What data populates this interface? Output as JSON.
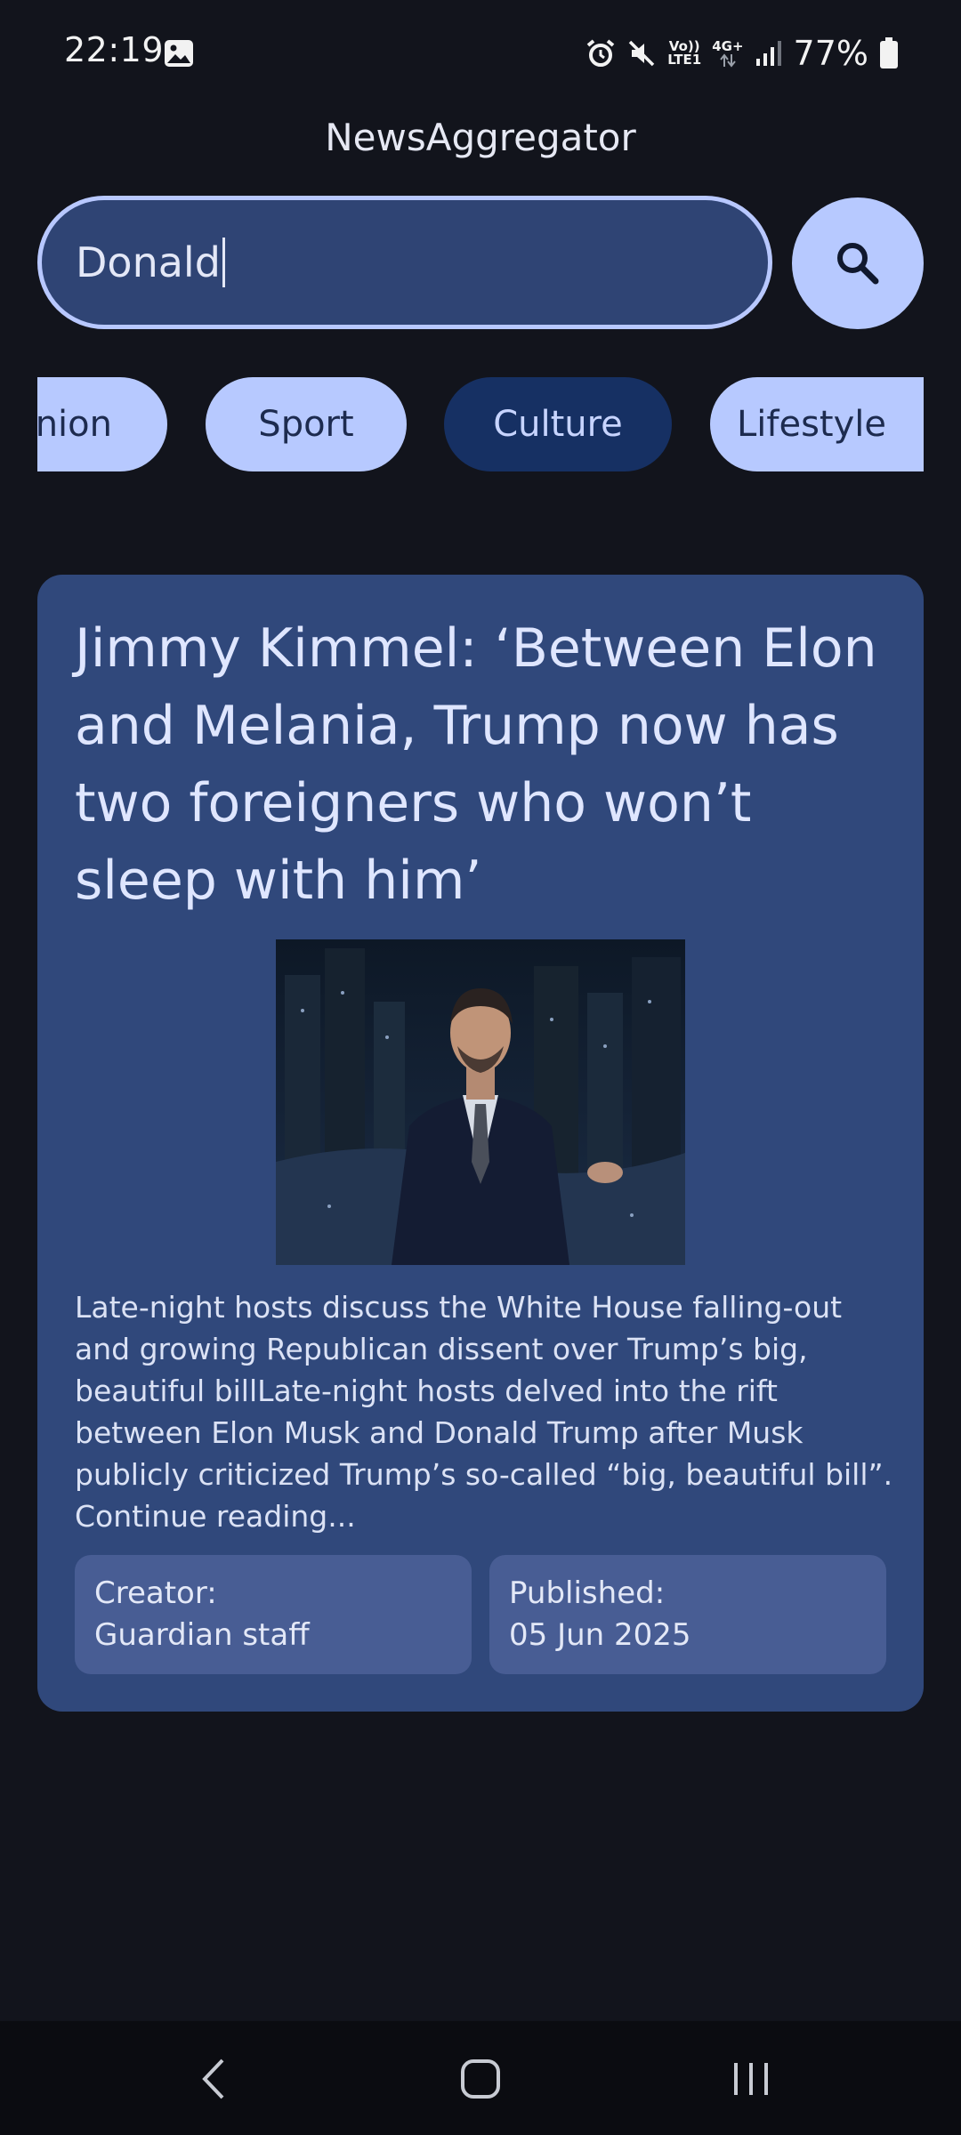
{
  "status_bar": {
    "time": "22:19",
    "network_top": "Vo))",
    "network_bottom": "LTE1",
    "data_type": "4G+",
    "battery": "77%"
  },
  "app": {
    "title": "NewsAggregator"
  },
  "search": {
    "value": "Donald",
    "icon": "search-icon"
  },
  "categories": [
    {
      "label": "inion",
      "selected": false
    },
    {
      "label": "Sport",
      "selected": false
    },
    {
      "label": "Culture",
      "selected": true
    },
    {
      "label": "Lifestyle",
      "selected": false
    }
  ],
  "article": {
    "title": "Jimmy Kimmel: ‘Between Elon and Melania, Trump now has two foreigners who won’t sleep with him’",
    "description": "Late-night hosts discuss the White House falling-out and growing Republican dissent over Trump’s big, beautiful billLate-night hosts delved into the rift between Elon Musk and Donald Trump after Musk publicly criticized Trump’s so-called “big, beautiful bill”. Continue reading...",
    "creator_label": "Creator:",
    "creator": "Guardian staff",
    "published_label": "Published:",
    "published": "05 Jun 2025"
  },
  "colors": {
    "background": "#12141c",
    "card": "#30487b",
    "chip": "#b7c9ff",
    "chip_selected": "#163063",
    "meta_box": "#485d94"
  }
}
